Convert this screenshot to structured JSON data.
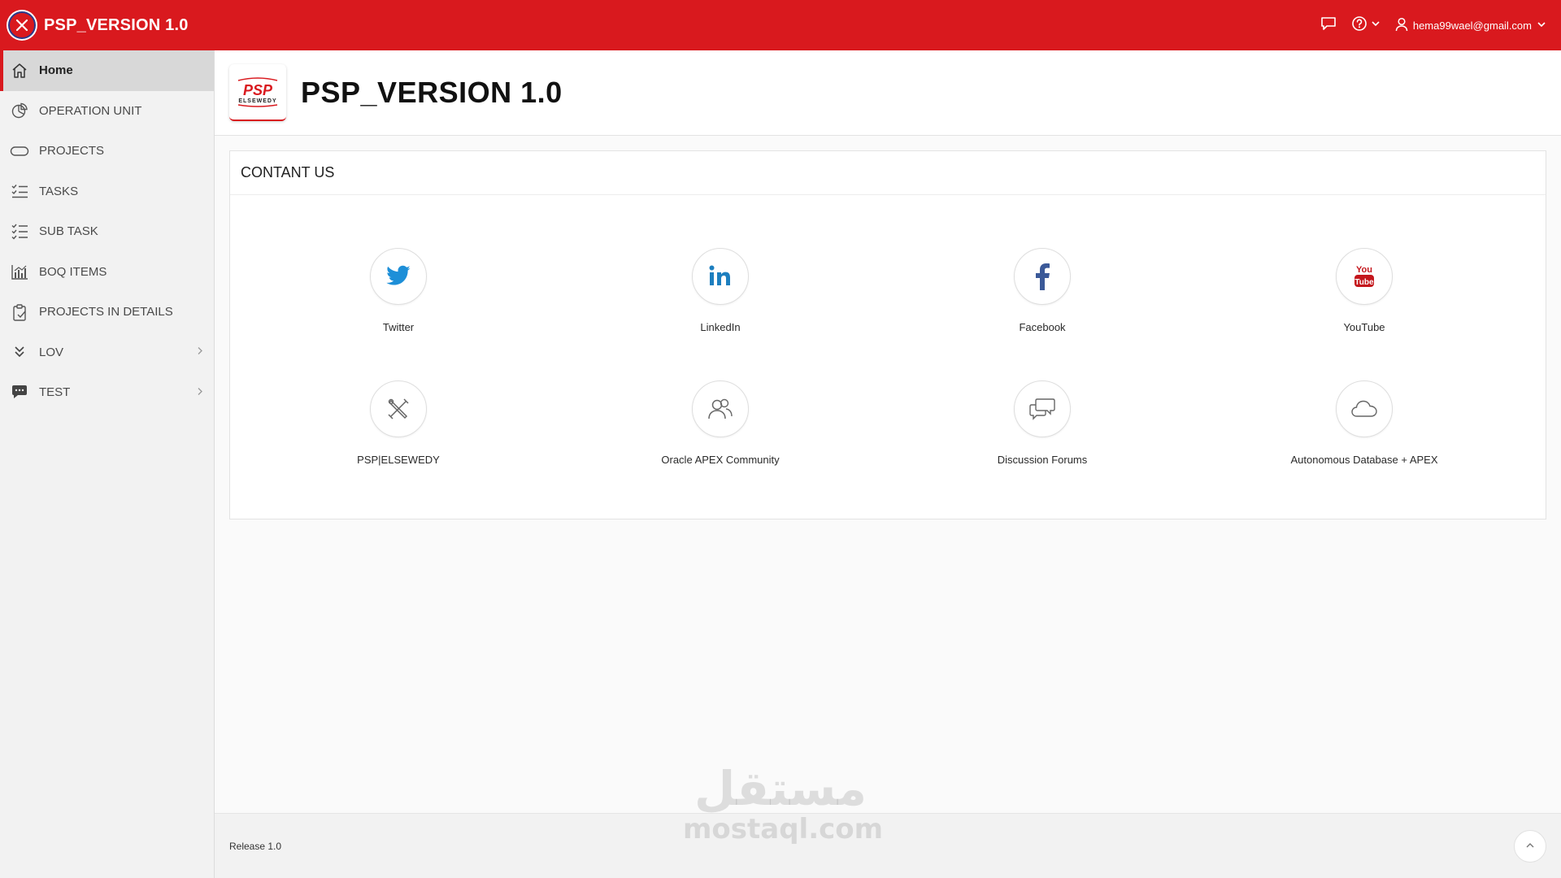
{
  "header": {
    "app_title": "PSP_VERSION 1.0",
    "user_email": "hema99wael@gmail.com",
    "icons": [
      "menu-toggle-icon",
      "chat-icon",
      "help-icon",
      "user-icon"
    ],
    "brand_color": "#d9191e"
  },
  "sidebar": {
    "items": [
      {
        "label": "Home",
        "icon": "home-icon",
        "active": true
      },
      {
        "label": "OPERATION UNIT",
        "icon": "pie-chart-icon"
      },
      {
        "label": "PROJECTS",
        "icon": "pill-icon"
      },
      {
        "label": "TASKS",
        "icon": "checklist-icon"
      },
      {
        "label": "SUB TASK",
        "icon": "checklist-icon"
      },
      {
        "label": "BOQ ITEMS",
        "icon": "bar-chart-icon"
      },
      {
        "label": "PROJECTS IN DETAILS",
        "icon": "clipboard-icon"
      },
      {
        "label": "LOV",
        "icon": "double-chevron-down-icon",
        "has_children": true
      },
      {
        "label": "TEST",
        "icon": "comment-icon",
        "has_children": true
      }
    ]
  },
  "hero": {
    "title": "PSP_VERSION 1.0",
    "logo_text": "PSP",
    "logo_subtext": "ELSEWEDY"
  },
  "region": {
    "title": "CONTANT US",
    "cards": [
      {
        "label": "Twitter",
        "icon": "twitter-icon"
      },
      {
        "label": "LinkedIn",
        "icon": "linkedin-icon"
      },
      {
        "label": "Facebook",
        "icon": "facebook-icon"
      },
      {
        "label": "YouTube",
        "icon": "youtube-icon"
      },
      {
        "label": "PSP|ELSEWEDY",
        "icon": "tools-icon"
      },
      {
        "label": "Oracle APEX Community",
        "icon": "users-icon"
      },
      {
        "label": "Discussion Forums",
        "icon": "comments-icon"
      },
      {
        "label": "Autonomous Database + APEX",
        "icon": "cloud-icon"
      }
    ]
  },
  "footer": {
    "release": "Release 1.0"
  },
  "watermark": {
    "arabic": "مستقل",
    "latin": "mostaql.com"
  }
}
